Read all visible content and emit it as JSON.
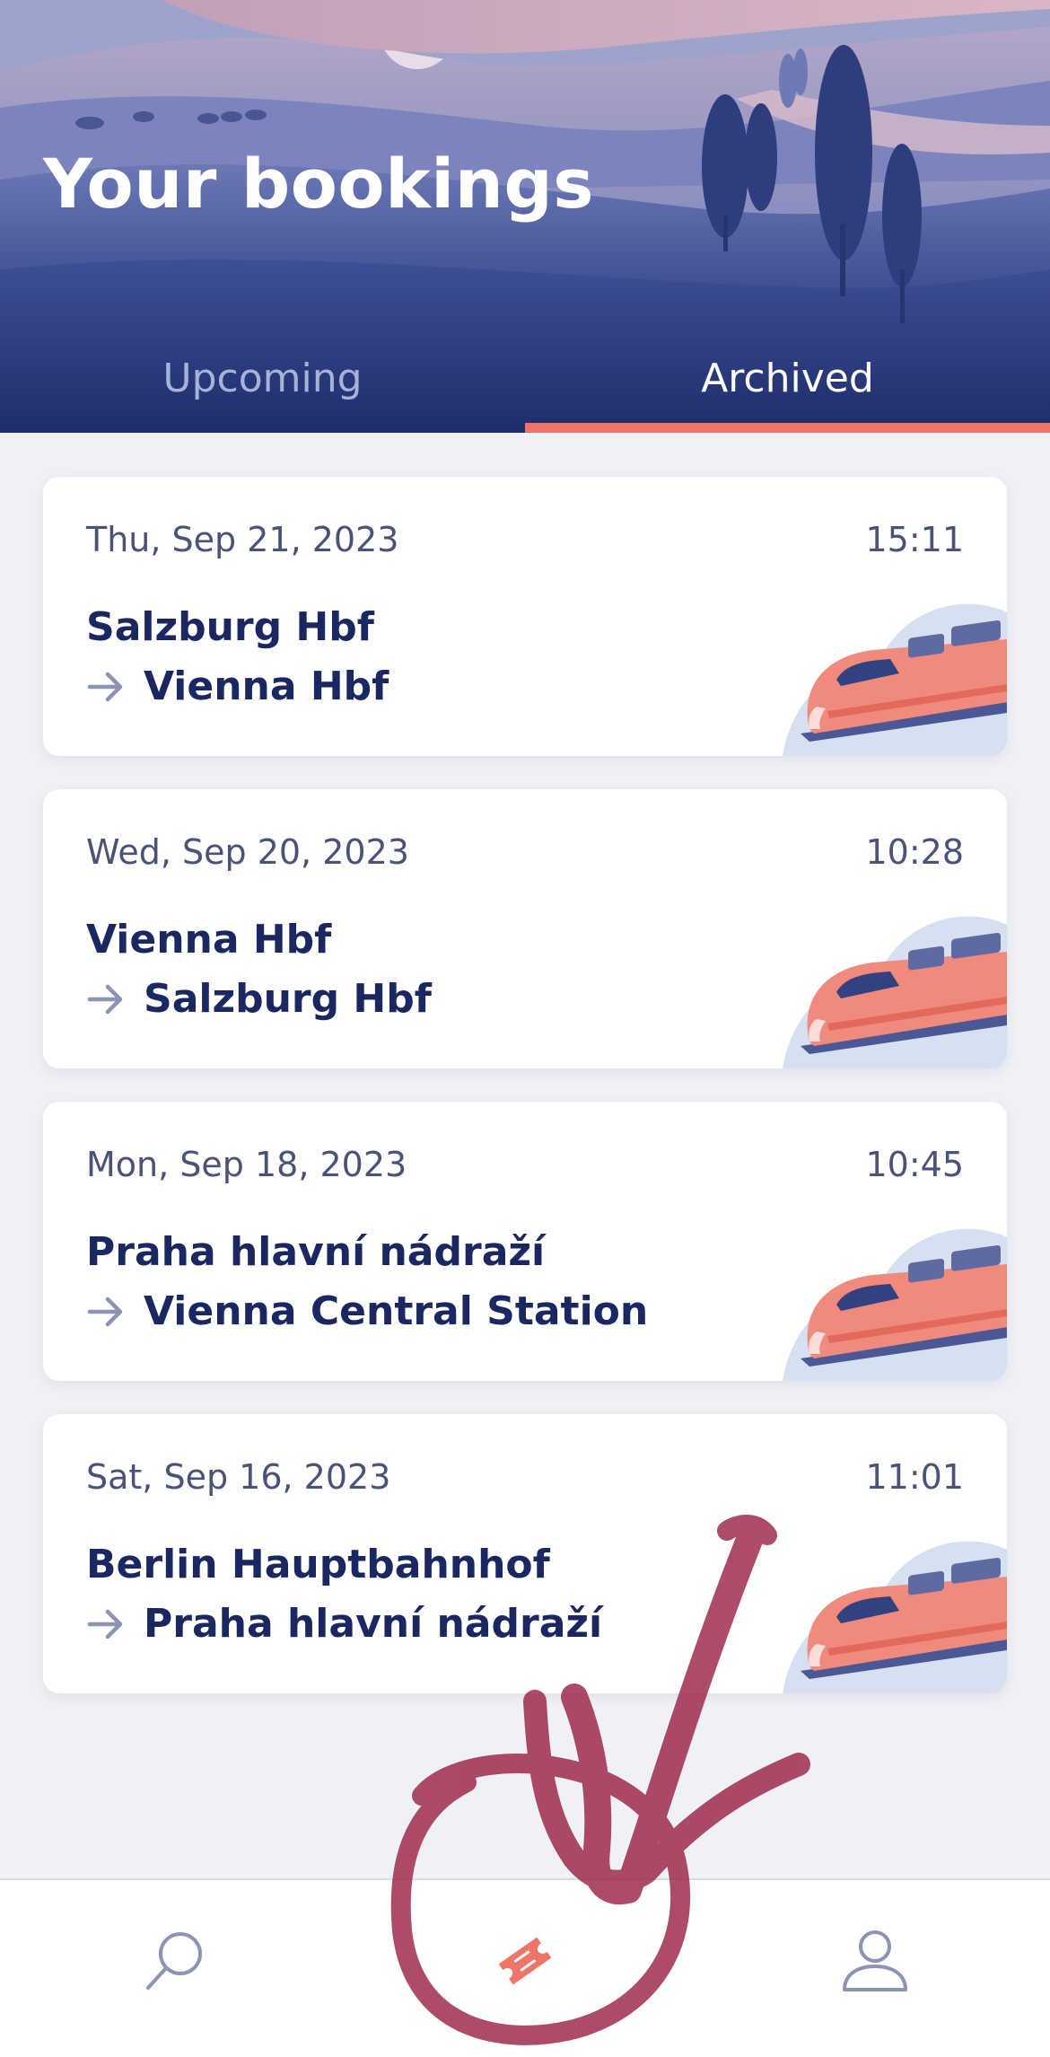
{
  "header": {
    "title": "Your bookings",
    "tabs": [
      {
        "label": "Upcoming",
        "active": false
      },
      {
        "label": "Archived",
        "active": true
      }
    ]
  },
  "bookings": [
    {
      "date": "Thu, Sep 21, 2023",
      "time": "15:11",
      "from": "Salzburg Hbf",
      "to": "Vienna Hbf"
    },
    {
      "date": "Wed, Sep 20, 2023",
      "time": "10:28",
      "from": "Vienna Hbf",
      "to": "Salzburg Hbf"
    },
    {
      "date": "Mon, Sep 18, 2023",
      "time": "10:45",
      "from": "Praha hlavní nádraží",
      "to": "Vienna Central Station"
    },
    {
      "date": "Sat, Sep 16, 2023",
      "time": "11:01",
      "from": "Berlin Hauptbahnhof",
      "to": "Praha hlavní nádraží"
    }
  ],
  "bottom_nav": {
    "items": [
      {
        "icon": "search-icon",
        "active": false
      },
      {
        "icon": "ticket-icon",
        "active": true
      },
      {
        "icon": "profile-icon",
        "active": false
      }
    ]
  },
  "colors": {
    "header_dark": "#1e2d6b",
    "accent": "#ee7468",
    "text_primary": "#1b2760",
    "text_secondary": "#4a5278",
    "tab_inactive": "#a7b2d9",
    "annotation": "#9b2546"
  }
}
